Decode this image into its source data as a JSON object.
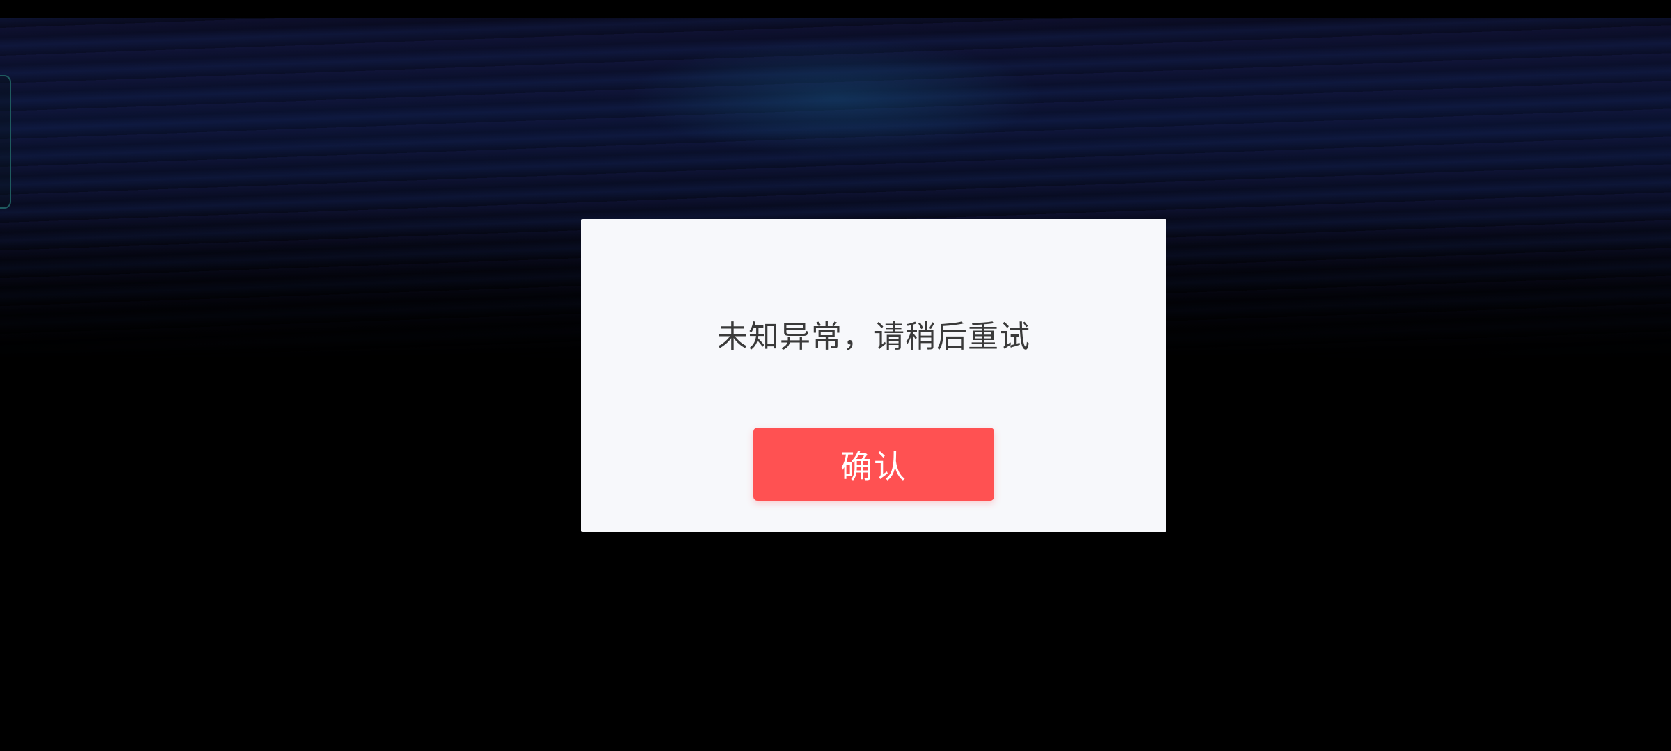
{
  "dialog": {
    "message": "未知异常，请稍后重试",
    "confirm_label": "确认"
  },
  "colors": {
    "confirm_button": "#ff5152",
    "dialog_background": "#f7f8fb",
    "message_text": "#3a3a3a",
    "side_tab_border": "#1f5a5e"
  }
}
